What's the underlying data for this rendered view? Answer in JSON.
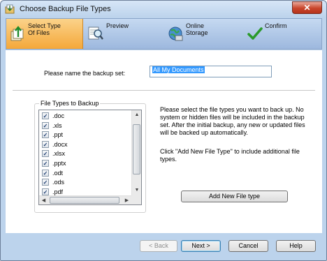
{
  "window": {
    "title": "Choose Backup File Types",
    "close_label": "✕"
  },
  "steps": [
    {
      "label": "Select Type\nOf Files",
      "icon": "upload-files-icon",
      "active": true
    },
    {
      "label": "Preview",
      "icon": "preview-magnifier-icon",
      "active": false
    },
    {
      "label": "Online\nStorage",
      "icon": "globe-storage-icon",
      "active": false
    },
    {
      "label": "Confirm",
      "icon": "checkmark-icon",
      "active": false
    }
  ],
  "form": {
    "name_label": "Please name the backup set:",
    "name_value": "All My Documents"
  },
  "file_types": {
    "legend": "File Types to Backup",
    "items": [
      {
        "label": ".doc",
        "checked": true
      },
      {
        "label": ".xls",
        "checked": true
      },
      {
        "label": ".ppt",
        "checked": true
      },
      {
        "label": ".docx",
        "checked": true
      },
      {
        "label": ".xlsx",
        "checked": true
      },
      {
        "label": ".pptx",
        "checked": true
      },
      {
        "label": ".odt",
        "checked": true
      },
      {
        "label": ".ods",
        "checked": true
      },
      {
        "label": ".pdf",
        "checked": true
      }
    ]
  },
  "info": {
    "paragraph1": "Please select the file types you want to back up. No system or hidden files will be included in the backup set. After the initial backup, any new or updated files will be backed up automatically.",
    "paragraph2": "Click \"Add New File Type\" to include additional file types."
  },
  "buttons": {
    "add_new": "Add New File type",
    "back": "< Back",
    "next": "Next >",
    "cancel": "Cancel",
    "help": "Help"
  },
  "colors": {
    "active_step": "#f4a83a",
    "selection": "#3399ff",
    "chrome": "#bcd3ec"
  }
}
